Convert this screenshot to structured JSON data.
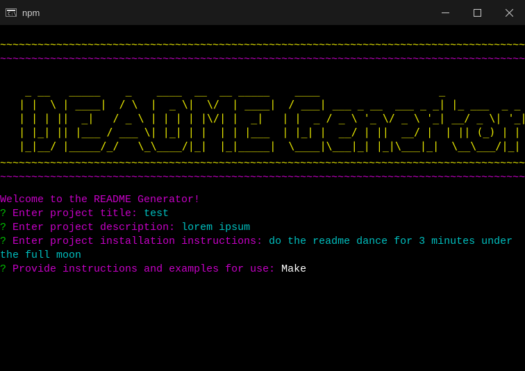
{
  "titlebar": {
    "title": "npm"
  },
  "waves": {
    "row": "~~~~~~~~~~~~~~~~~~~~~~~~~~~~~~~~~~~~~~~~~~~~~~~~~~~~~~~~~~~~~~~~~~~~~~~~~~~~~~~~~~~~~~~~~~~~~~~~~~~~~~~~~~~~~~~~~~~~~~~~~~~~~~~~~~~~~~~~~~~~~~~~~~~~~~~~~~~~~~~~~~~~~~~~~~~~~~~~~~~~~~~~~~~~~~~~~~~~~~~~~~~~~~~~~~~~~~~~~~~~~~~~~~~~~~~~~~~~~~~~~~~~~~~~~~~~~~~~~~~~~~~~~~~~~~~~~~~~~~~~~~~~~~~~~~~~~~~~~~~~~~~~~~~~~~~~~~~~~~~~~~~~~~~~~~~~~~~~~~~~~~~~~~~~~~~~~~~~~~~~~~~~~~~~~~~~~~~~~~~~~~~~~~~~~~~~~~~~~~~~"
  },
  "ascii_art": "    _ __   _____    _    ____  __  __ _____    ____                   _\n   | |  \\ | ____|  / \\  |  _ \\|  \\/  | ____|  / ___| ___ _ __  ___ _ _| |_ ___  _ _\n   | | | ||  _|   / _ \\ | | | | |\\/| |  _|   | |  _ / _ \\ '_ \\/ _ \\ '_| __/ _ \\| '_|\n   | |_| || |___ / ___ \\| |_| | |  | | |___  | |_| |  __/ | ||  __/ |  | || (_) | |\n   |_|__/ |_____/_/   \\_\\____/|_|  |_|_____|  \\____|\\___|_| |_|\\___|_|  \\__\\___/|_|",
  "welcome": "Welcome to the README Generator!",
  "prompts": {
    "q": "?",
    "items": [
      {
        "label": "Enter project title:",
        "answer": "test",
        "current": false
      },
      {
        "label": "Enter project description:",
        "answer": "lorem ipsum",
        "current": false
      },
      {
        "label": "Enter project installation instructions:",
        "answer": "do the readme dance for 3 minutes under the full moon",
        "current": false
      },
      {
        "label": "Provide instructions and examples for use:",
        "answer": "Make",
        "current": true
      }
    ]
  }
}
